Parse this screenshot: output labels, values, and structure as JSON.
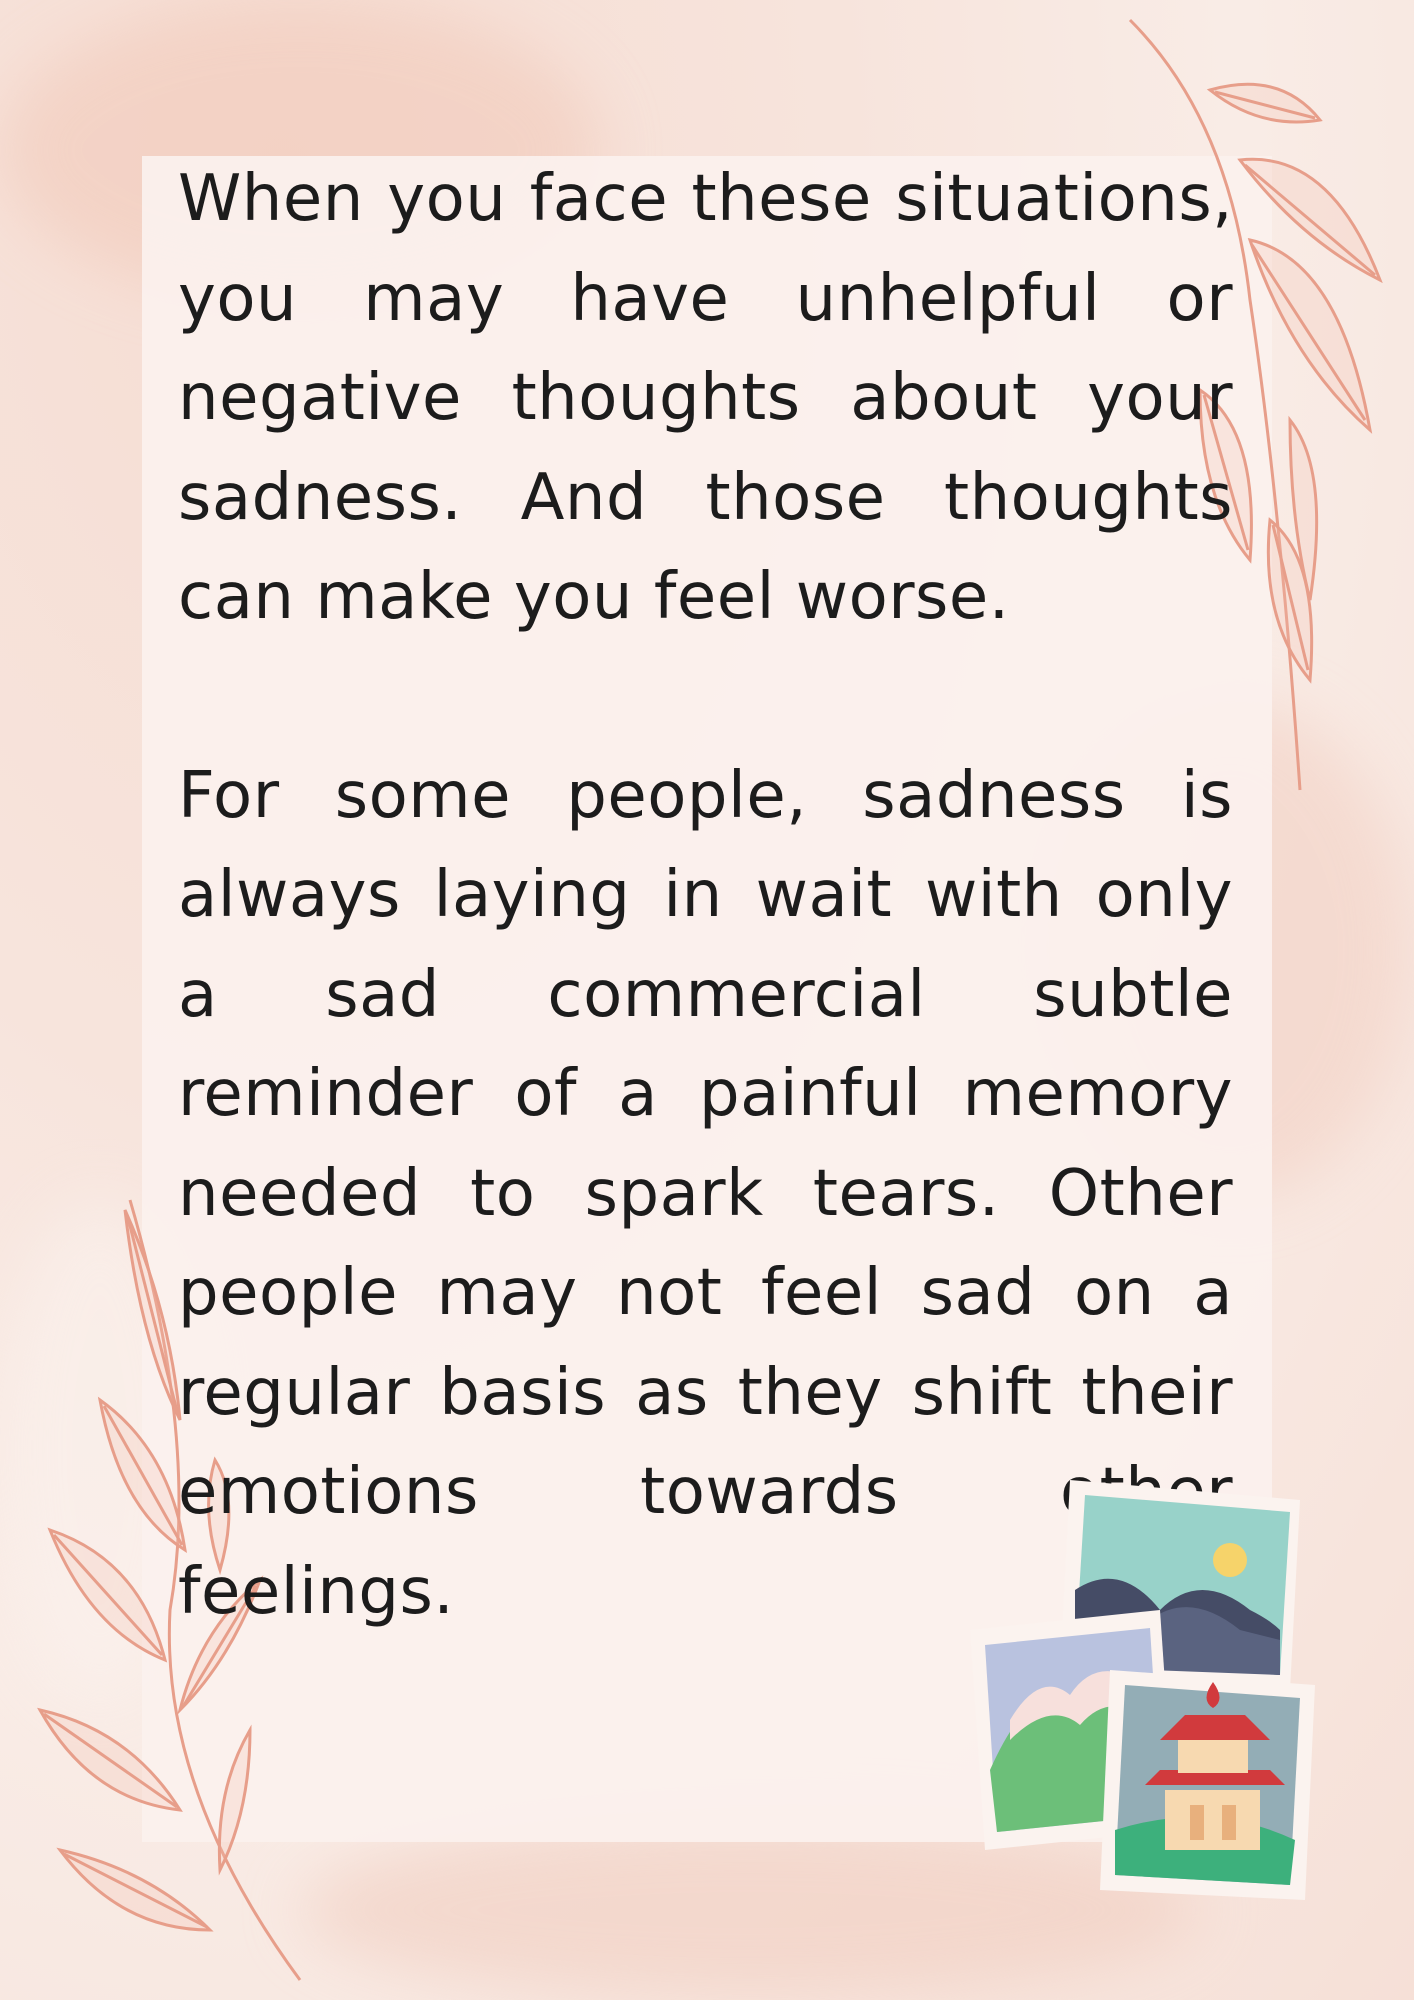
{
  "page": {
    "paragraphs": [
      "When you face these situations, you may have unhelpful or negative thoughts about your sadness. And those thoughts can make you feel worse.",
      "For some people, sadness is always laying in wait with only a sad commercial subtle reminder of a painful memory needed to spark tears. Other people may not feel sad on a regular basis as they shift their emotions towards other feelings."
    ]
  },
  "decorations": {
    "background_color": "#f7e4dc",
    "leaf_color": "#e79e8a",
    "icons": [
      "leaf-branch-icon",
      "mountain-sun-photo-icon",
      "snowy-mountain-photo-icon",
      "pagoda-photo-icon"
    ]
  }
}
